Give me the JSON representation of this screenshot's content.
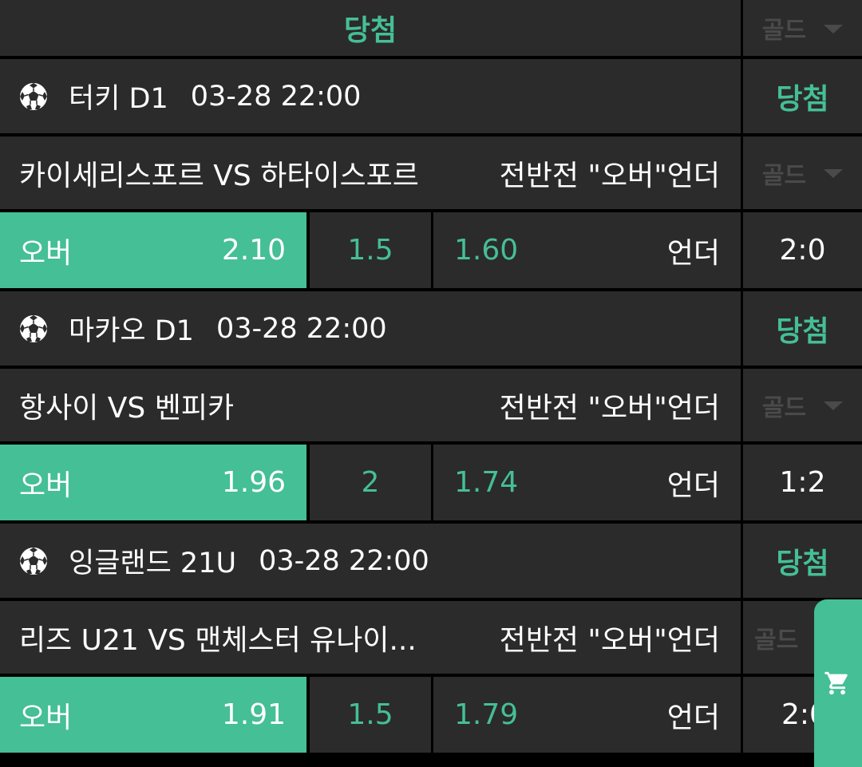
{
  "header": {
    "status": "당첨",
    "gold": "골드"
  },
  "matches": [
    {
      "league": "터키 D1",
      "time": "03-28 22:00",
      "status": "당첨",
      "teams": "카이세리스포르 VS 하타이스포르",
      "market": "전반전 \"오버\"언더",
      "gold": "골드",
      "over_label": "오버",
      "over_odds": "2.10",
      "line": "1.5",
      "under_odds": "1.60",
      "under_label": "언더",
      "score": "2:0"
    },
    {
      "league": "마카오 D1",
      "time": "03-28 22:00",
      "status": "당첨",
      "teams": "항사이 VS 벤피카",
      "market": "전반전 \"오버\"언더",
      "gold": "골드",
      "over_label": "오버",
      "over_odds": "1.96",
      "line": "2",
      "under_odds": "1.74",
      "under_label": "언더",
      "score": "1:2"
    },
    {
      "league": "잉글랜드 21U",
      "time": "03-28 22:00",
      "status": "당첨",
      "teams": "리즈 U21 VS 맨체스터 유나이...",
      "market": "전반전 \"오버\"언더",
      "gold": "골드",
      "over_label": "오버",
      "over_odds": "1.91",
      "line": "1.5",
      "under_odds": "1.79",
      "under_label": "언더",
      "score": "2:0"
    }
  ],
  "colors": {
    "accent": "#45bf95",
    "panel": "#2b2b2b",
    "background": "#000000",
    "dim": "#4a4a4a"
  },
  "icons": {
    "sport": "soccer-ball-icon",
    "cart": "cart-icon",
    "dropdown": "triangle-down-icon"
  }
}
